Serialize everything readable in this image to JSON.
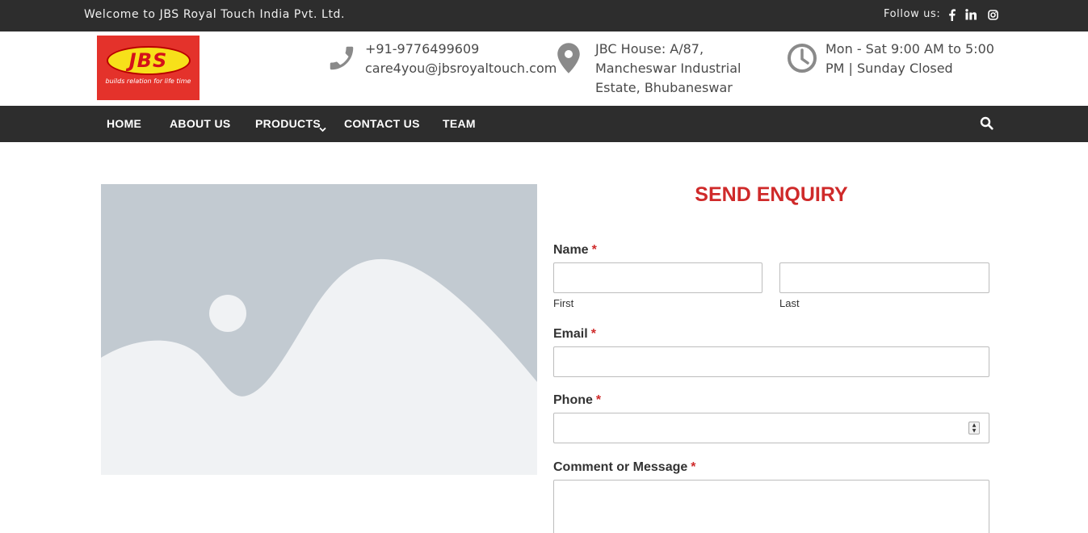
{
  "topbar": {
    "welcome": "Welcome to JBS Royal Touch India Pvt. Ltd.",
    "follow_label": "Follow us:",
    "social_icons": [
      "facebook-icon",
      "linkedin-icon",
      "instagram-icon"
    ]
  },
  "header": {
    "logo": {
      "text": "JBS",
      "tagline": "builds relation for life time"
    },
    "contact": {
      "phone": "+91-9776499609",
      "email": "care4you@jbsroyaltouch.com"
    },
    "address": {
      "line1": "JBC House: A/87,",
      "line2": "Mancheswar Industrial",
      "line3": "Estate, Bhubaneswar"
    },
    "hours": {
      "line1": "Mon - Sat 9:00 AM to 5:00",
      "line2": "PM | Sunday Closed"
    }
  },
  "nav": {
    "items": [
      {
        "label": "HOME"
      },
      {
        "label": "ABOUT US"
      },
      {
        "label": "PRODUCTS"
      },
      {
        "label": "CONTACT US"
      },
      {
        "label": "TEAM"
      }
    ]
  },
  "form": {
    "title": "SEND ENQUIRY",
    "required_marker": "*",
    "name_label": "Name",
    "first_sublabel": "First",
    "last_sublabel": "Last",
    "first_value": "",
    "last_value": "",
    "email_label": "Email",
    "email_value": "",
    "phone_label": "Phone",
    "phone_value": "",
    "message_label": "Comment or Message",
    "message_value": ""
  },
  "colors": {
    "dark_bar": "#2d2d2d",
    "accent_red": "#cf2a2a",
    "placeholder_bg": "#c2cad1",
    "placeholder_fg": "#f0f2f4"
  }
}
